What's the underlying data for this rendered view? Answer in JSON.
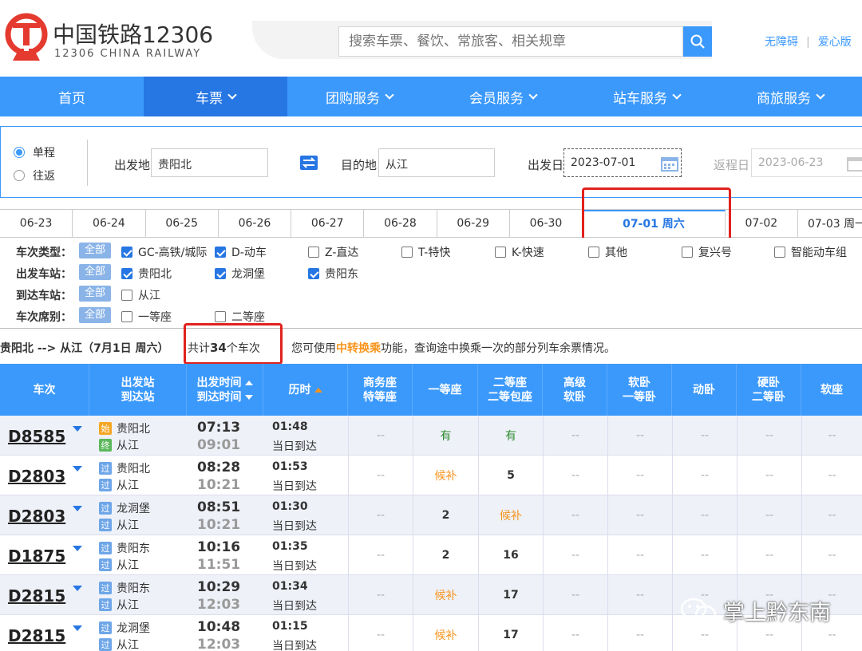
{
  "header": {
    "brand_cn": "中国铁路12306",
    "brand_en": "12306 CHINA RAILWAY",
    "search_placeholder": "搜索车票、餐饮、常旅客、相关规章",
    "link_accessible": "无障碍",
    "link_care": "爱心版"
  },
  "nav": {
    "items": [
      "首页",
      "车票",
      "团购服务",
      "会员服务",
      "站车服务",
      "商旅服务"
    ]
  },
  "query": {
    "trip_one_way": "单程",
    "trip_round": "往返",
    "from_label": "出发地",
    "from_value": "贵阳北",
    "to_label": "目的地",
    "to_value": "从江",
    "depart_label": "出发日",
    "depart_value": "2023-07-01",
    "return_label": "返程日",
    "return_value": "2023-06-23"
  },
  "date_tabs": [
    "06-23",
    "06-24",
    "06-25",
    "06-26",
    "06-27",
    "06-28",
    "06-29",
    "06-30",
    "07-01 周六",
    "07-02",
    "07-03 周一"
  ],
  "filters": {
    "all_label": "全部",
    "type_label": "车次类型：",
    "type_options": [
      "GC-高铁/城际",
      "D-动车",
      "Z-直达",
      "T-特快",
      "K-快速",
      "其他",
      "复兴号",
      "智能动车组"
    ],
    "from_label": "出发车站：",
    "from_options": [
      "贵阳北",
      "龙洞堡",
      "贵阳东"
    ],
    "to_label": "到达车站：",
    "to_options": [
      "从江"
    ],
    "seat_label": "车次席别：",
    "seat_options": [
      "一等座",
      "二等座"
    ]
  },
  "summary": {
    "route": "贵阳北 --> 从江（7月1日  周六）",
    "count_prefix": "共计",
    "count": "34",
    "count_suffix": "个车次",
    "tip_prefix": "您可使用",
    "tip_highlight": "中转换乘",
    "tip_suffix": "功能，查询途中换乘一次的部分列车余票情况。"
  },
  "table": {
    "headers": {
      "train": "车次",
      "stations_1": "出发站",
      "stations_2": "到达站",
      "time_1": "出发时间",
      "time_2": "到达时间",
      "duration": "历时",
      "business_1": "商务座",
      "business_2": "特等座",
      "first": "一等座",
      "second_1": "二等座",
      "second_2": "二等包座",
      "sleeper_1": "高级",
      "sleeper_2": "软卧",
      "soft_sleeper_1": "软卧",
      "soft_sleeper_2": "一等卧",
      "moving_sleeper": "动卧",
      "hard_sleeper_1": "硬卧",
      "hard_sleeper_2": "二等卧",
      "soft_seat": "软座"
    },
    "badges": {
      "start": "始",
      "end": "终",
      "pass": "过"
    },
    "rows": [
      {
        "train": "D8585",
        "from": "贵阳北",
        "to": "从江",
        "from_badge": "始",
        "to_badge": "终",
        "dep": "07:13",
        "arr": "09:01",
        "dur": "01:48",
        "note": "当日到达",
        "business": "--",
        "first": "有",
        "second": "有",
        "sleeper": "--",
        "soft_sleeper": "--",
        "moving": "--",
        "hard": "--",
        "soft_seat": "--"
      },
      {
        "train": "D2803",
        "from": "贵阳北",
        "to": "从江",
        "from_badge": "过",
        "to_badge": "过",
        "dep": "08:28",
        "arr": "10:21",
        "dur": "01:53",
        "note": "当日到达",
        "business": "--",
        "first": "候补",
        "second": "5",
        "sleeper": "--",
        "soft_sleeper": "--",
        "moving": "--",
        "hard": "--",
        "soft_seat": "--"
      },
      {
        "train": "D2803",
        "from": "龙洞堡",
        "to": "从江",
        "from_badge": "过",
        "to_badge": "过",
        "dep": "08:51",
        "arr": "10:21",
        "dur": "01:30",
        "note": "当日到达",
        "business": "--",
        "first": "2",
        "second": "候补",
        "sleeper": "--",
        "soft_sleeper": "--",
        "moving": "--",
        "hard": "--",
        "soft_seat": "--"
      },
      {
        "train": "D1875",
        "from": "贵阳东",
        "to": "从江",
        "from_badge": "过",
        "to_badge": "过",
        "dep": "10:16",
        "arr": "11:51",
        "dur": "01:35",
        "note": "当日到达",
        "business": "--",
        "first": "2",
        "second": "16",
        "sleeper": "--",
        "soft_sleeper": "--",
        "moving": "--",
        "hard": "--",
        "soft_seat": "--"
      },
      {
        "train": "D2815",
        "from": "贵阳东",
        "to": "从江",
        "from_badge": "过",
        "to_badge": "过",
        "dep": "10:29",
        "arr": "12:03",
        "dur": "01:34",
        "note": "当日到达",
        "business": "--",
        "first": "候补",
        "second": "17",
        "sleeper": "--",
        "soft_sleeper": "--",
        "moving": "--",
        "hard": "--",
        "soft_seat": "--"
      },
      {
        "train": "D2815",
        "from": "龙洞堡",
        "to": "从江",
        "from_badge": "过",
        "to_badge": "过",
        "dep": "10:48",
        "arr": "12:03",
        "dur": "01:15",
        "note": "当日到达",
        "business": "--",
        "first": "候补",
        "second": "17",
        "sleeper": "--",
        "soft_sleeper": "--",
        "moving": "--",
        "hard": "--",
        "soft_seat": "--"
      }
    ]
  },
  "watermark": "掌上黔东南",
  "colors": {
    "brand_blue": "#3b99fc",
    "nav_active": "#2676e3",
    "highlight_red": "#e0221e",
    "orange": "#f7941d",
    "green": "#2e8b2e",
    "logo_red": "#e43a2f"
  }
}
